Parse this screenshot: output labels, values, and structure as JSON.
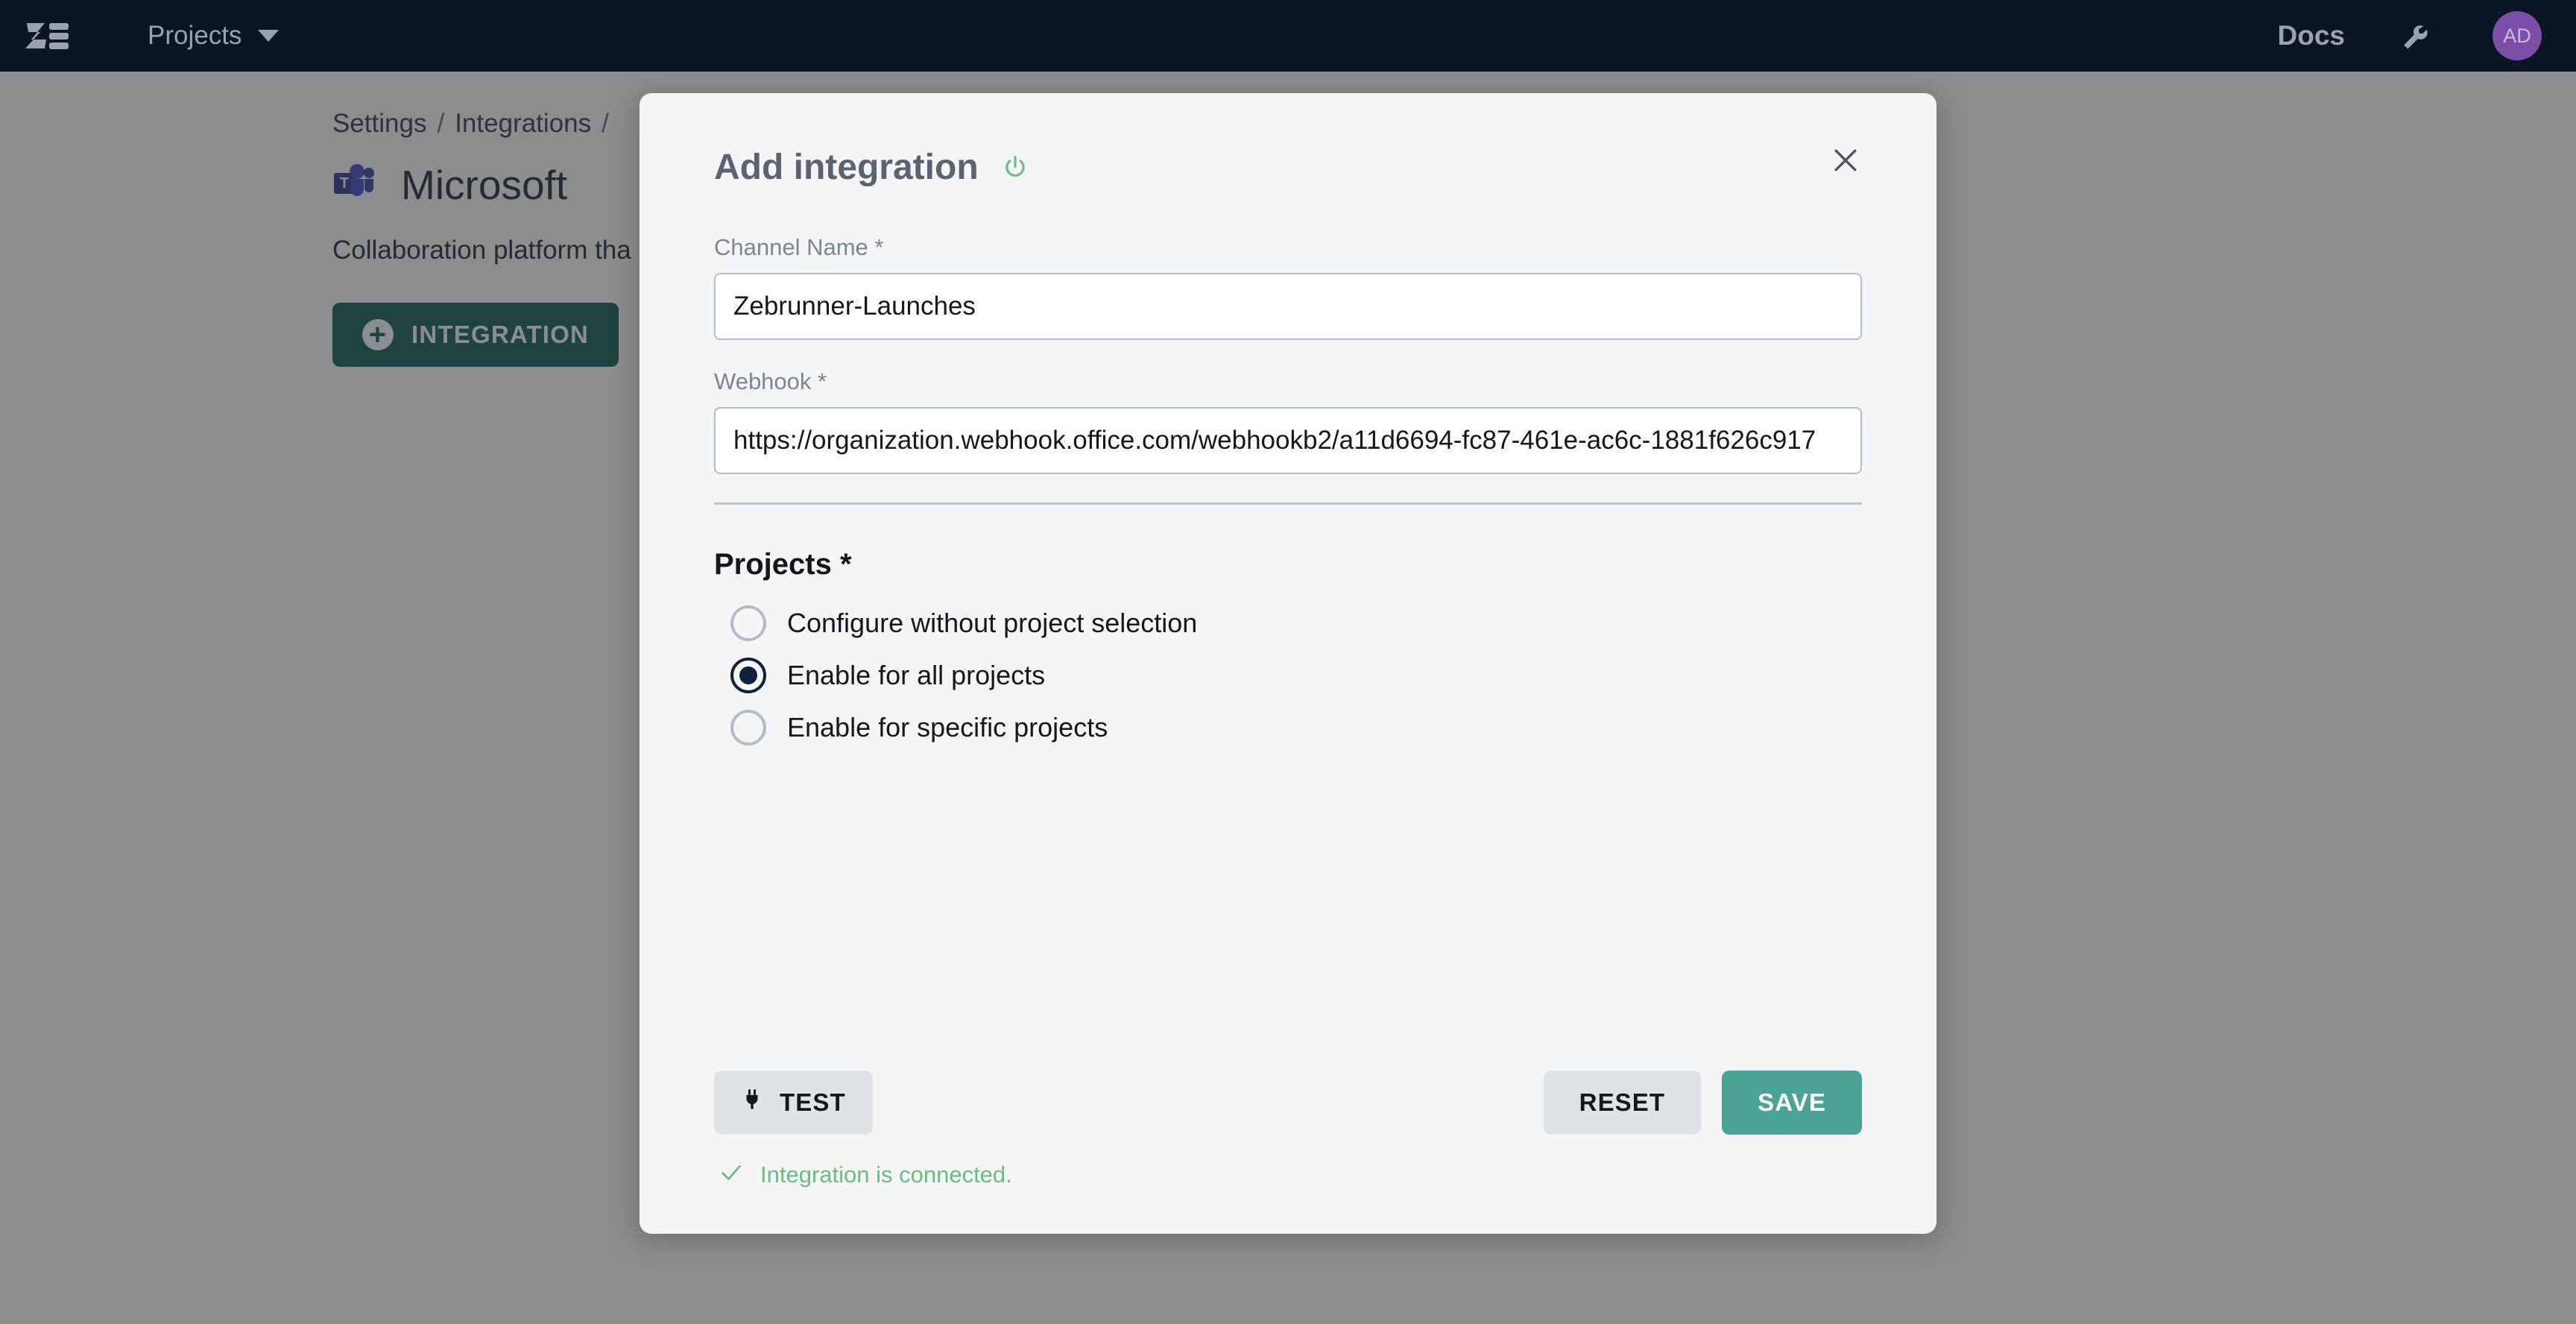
{
  "topbar": {
    "logo_name": "zebrunner-logo",
    "projects_label": "Projects",
    "docs_label": "Docs",
    "wrench_icon": "wrench-icon",
    "avatar_initials": "AD",
    "avatar_color": "#7b4fa8",
    "background_color": "#0a1623"
  },
  "page": {
    "breadcrumb": [
      "Settings",
      "/",
      "Integrations",
      "/"
    ],
    "integration_title": "Microsoft",
    "integration_description": "Collaboration platform tha",
    "add_integration_label": "INTEGRATION",
    "add_integration_color": "#1f6658",
    "teams_icon": "microsoft-teams-icon"
  },
  "modal": {
    "title": "Add integration",
    "power_icon": "power-icon",
    "power_icon_color": "#6abd7f",
    "close_icon": "close-icon",
    "fields": [
      {
        "label": "Channel Name *",
        "value": "Zebrunner-Launches",
        "placeholder": "Channel Name",
        "name": "channel-name-input"
      },
      {
        "label": "Webhook *",
        "value": "https://organization.webhook.office.com/webhookb2/a11d6694-fc87-461e-ac6c-1881f626c917",
        "placeholder": "Webhook",
        "name": "webhook-input"
      }
    ],
    "projects": {
      "section_title": "Projects *",
      "options": [
        {
          "label": "Configure without project selection",
          "checked": false
        },
        {
          "label": "Enable for all projects",
          "checked": true
        },
        {
          "label": "Enable for specific projects",
          "checked": false
        }
      ]
    },
    "footer": {
      "test_label": "TEST",
      "test_icon": "plug-icon",
      "reset_label": "RESET",
      "save_label": "SAVE",
      "save_color": "#4ba396",
      "status_icon": "check-icon",
      "status_text": "Integration is connected.",
      "status_color": "#6abd7f"
    }
  }
}
